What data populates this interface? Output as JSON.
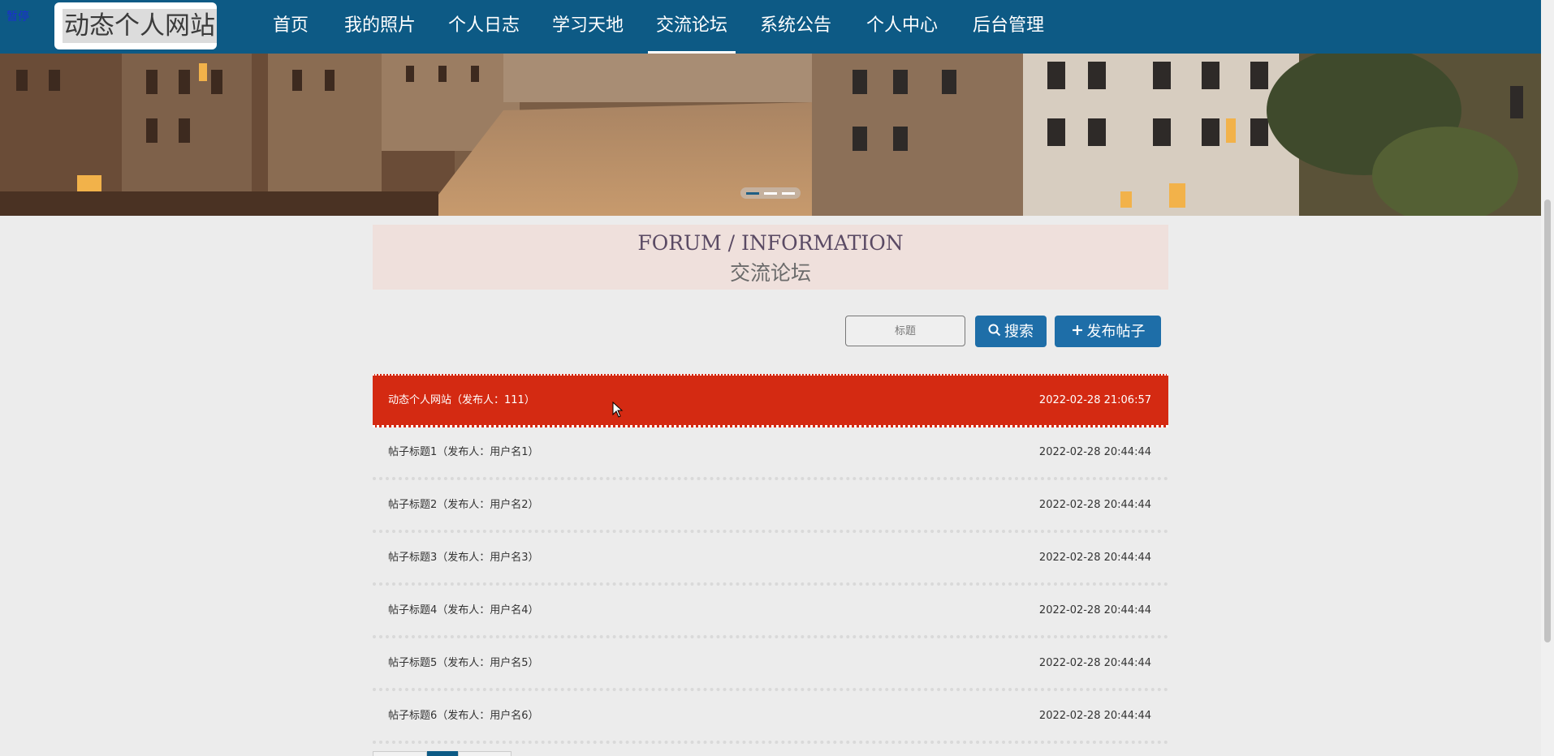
{
  "header": {
    "pause_label": "暂停",
    "logo_text": "动态个人网站",
    "nav": [
      {
        "label": "首页"
      },
      {
        "label": "我的照片"
      },
      {
        "label": "个人日志"
      },
      {
        "label": "学习天地"
      },
      {
        "label": "交流论坛",
        "active": true
      },
      {
        "label": "系统公告"
      },
      {
        "label": "个人中心"
      },
      {
        "label": "后台管理"
      }
    ]
  },
  "banner": {
    "slides": 3,
    "active_slide": 1
  },
  "section": {
    "title_en": "FORUM / INFORMATION",
    "title_cn": "交流论坛"
  },
  "search": {
    "placeholder": "标题",
    "search_label": "搜索",
    "post_label": "发布帖子"
  },
  "forum": {
    "rows": [
      {
        "title": "动态个人网站（发布人：111）",
        "date": "2022-02-28 21:06:57",
        "highlight": true
      },
      {
        "title": "帖子标题1（发布人：用户名1）",
        "date": "2022-02-28 20:44:44"
      },
      {
        "title": "帖子标题2（发布人：用户名2）",
        "date": "2022-02-28 20:44:44"
      },
      {
        "title": "帖子标题3（发布人：用户名3）",
        "date": "2022-02-28 20:44:44"
      },
      {
        "title": "帖子标题4（发布人：用户名4）",
        "date": "2022-02-28 20:44:44"
      },
      {
        "title": "帖子标题5（发布人：用户名5）",
        "date": "2022-02-28 20:44:44"
      },
      {
        "title": "帖子标题6（发布人：用户名6）",
        "date": "2022-02-28 20:44:44"
      }
    ]
  },
  "colors": {
    "header_bg": "#0d5a85",
    "accent_button": "#1e6ea8",
    "highlight_row": "#d42a12",
    "title_block_bg": "#efe0dc"
  }
}
